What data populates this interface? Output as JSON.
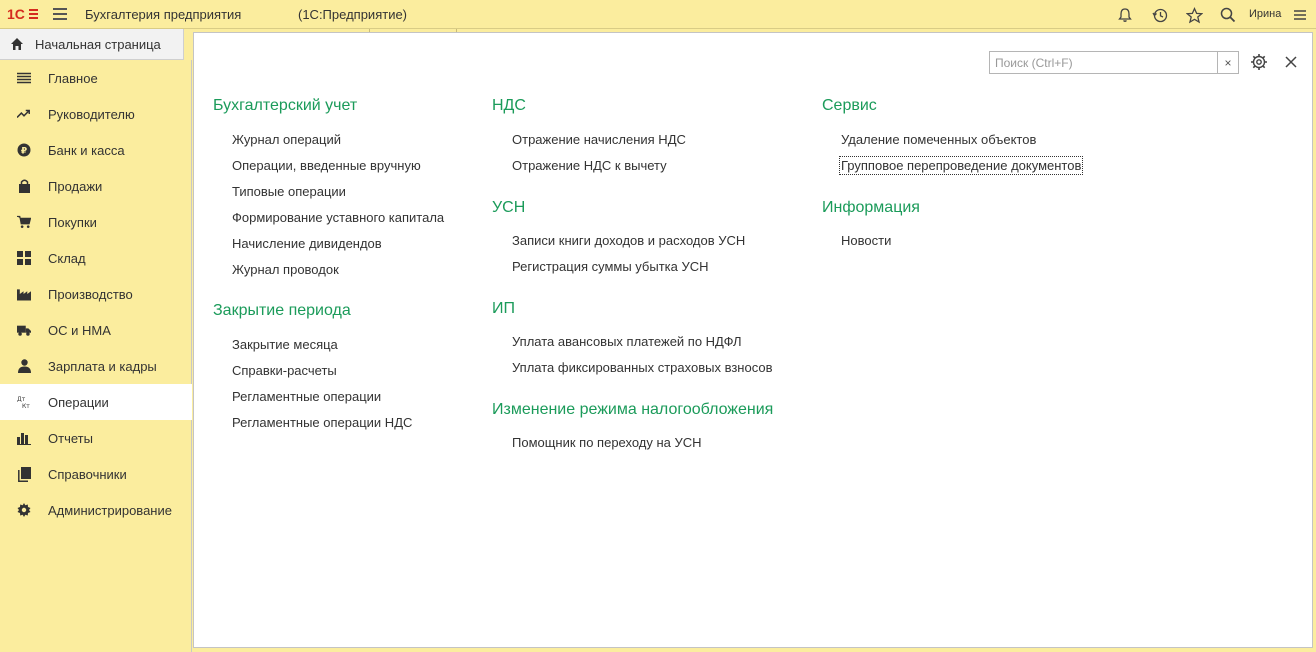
{
  "app": {
    "title": "Бухгалтерия предприятия",
    "subtitle": "(1С:Предприятие)",
    "user": "Ирина",
    "accent": "#1b9b5a",
    "background": "#fbed9e"
  },
  "top_icons": [
    "bell-icon",
    "history-icon",
    "star-icon",
    "search-icon",
    "more-icon"
  ],
  "home_tab": {
    "label": "Начальная страница"
  },
  "sidebar": {
    "items": [
      {
        "label": "Главное",
        "icon": "menu-icon"
      },
      {
        "label": "Руководителю",
        "icon": "trend-icon"
      },
      {
        "label": "Банк и касса",
        "icon": "ruble-icon"
      },
      {
        "label": "Продажи",
        "icon": "bag-icon"
      },
      {
        "label": "Покупки",
        "icon": "cart-icon"
      },
      {
        "label": "Склад",
        "icon": "warehouse-icon"
      },
      {
        "label": "Производство",
        "icon": "factory-icon"
      },
      {
        "label": "ОС и НМА",
        "icon": "truck-icon"
      },
      {
        "label": "Зарплата и кадры",
        "icon": "person-icon"
      },
      {
        "label": "Операции",
        "icon": "dt-kt-icon",
        "active": true
      },
      {
        "label": "Отчеты",
        "icon": "bar-chart-icon"
      },
      {
        "label": "Справочники",
        "icon": "books-icon"
      },
      {
        "label": "Администрирование",
        "icon": "gear-icon"
      }
    ]
  },
  "panel": {
    "search_placeholder": "Поиск (Ctrl+F)",
    "search_clear": "×",
    "columns": [
      {
        "groups": [
          {
            "title": "Бухгалтерский учет",
            "links": [
              "Журнал операций",
              "Операции, введенные вручную",
              "Типовые операции",
              "Формирование уставного капитала",
              "Начисление дивидендов",
              "Журнал проводок"
            ]
          },
          {
            "title": "Закрытие периода",
            "links": [
              "Закрытие месяца",
              "Справки-расчеты",
              "Регламентные операции",
              "Регламентные операции НДС"
            ]
          }
        ]
      },
      {
        "groups": [
          {
            "title": "НДС",
            "links": [
              "Отражение начисления НДС",
              "Отражение НДС к вычету"
            ]
          },
          {
            "title": "УСН",
            "links": [
              "Записи книги доходов и расходов УСН",
              "Регистрация суммы убытка УСН"
            ]
          },
          {
            "title": "ИП",
            "links": [
              "Уплата авансовых платежей по НДФЛ",
              "Уплата фиксированных страховых взносов"
            ]
          },
          {
            "title": "Изменение режима налогообложения",
            "links": [
              "Помощник по переходу на УСН"
            ]
          }
        ]
      },
      {
        "groups": [
          {
            "title": "Сервис",
            "links": [
              "Удаление помеченных объектов",
              "Групповое перепроведение документов"
            ]
          },
          {
            "title": "Информация",
            "links": [
              "Новости"
            ]
          }
        ]
      }
    ]
  }
}
